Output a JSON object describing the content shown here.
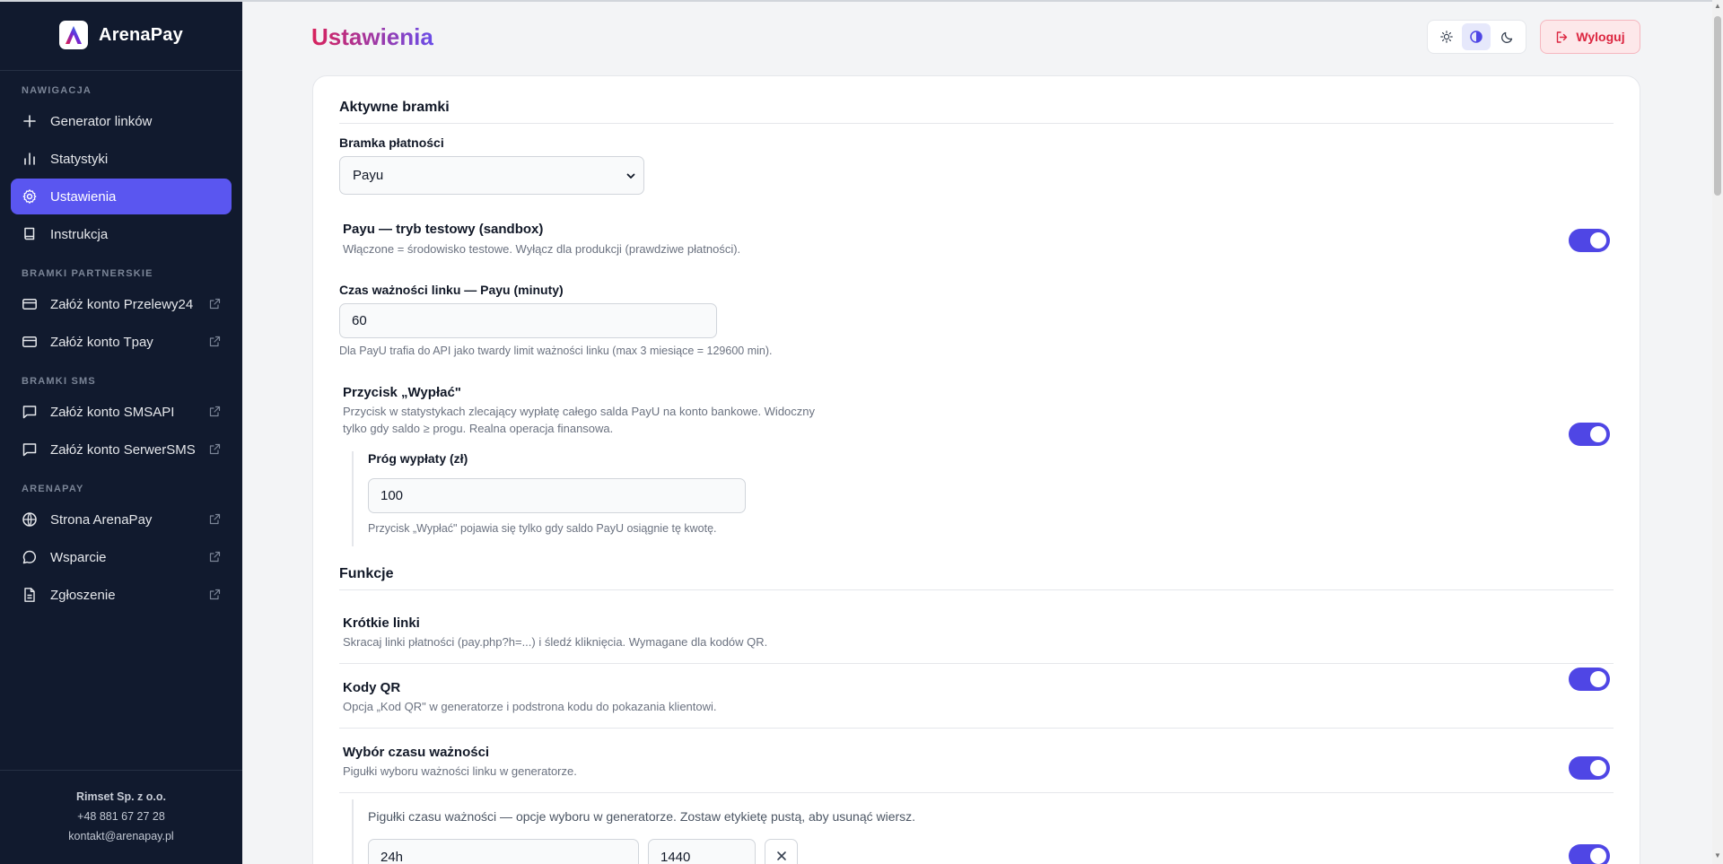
{
  "brand": {
    "name": "ArenaPay"
  },
  "sidebar": {
    "sections": {
      "nav": "NAWIGACJA",
      "partners": "BRAMKI PARTNERSKIE",
      "sms": "BRAMKI SMS",
      "arenapay": "ARENAPAY"
    },
    "items": [
      {
        "label": "Generator linków",
        "icon": "plus-icon"
      },
      {
        "label": "Statystyki",
        "icon": "bar-chart-icon"
      },
      {
        "label": "Ustawienia",
        "icon": "gear-icon",
        "active": true
      },
      {
        "label": "Instrukcja",
        "icon": "book-icon"
      },
      {
        "label": "Załóż konto Przelewy24",
        "icon": "credit-card-icon",
        "external": true
      },
      {
        "label": "Załóż konto Tpay",
        "icon": "credit-card-icon",
        "external": true
      },
      {
        "label": "Załóż konto SMSAPI",
        "icon": "message-icon",
        "external": true
      },
      {
        "label": "Załóż konto SerwerSMS",
        "icon": "message-icon",
        "external": true
      },
      {
        "label": "Strona ArenaPay",
        "icon": "globe-icon",
        "external": true
      },
      {
        "label": "Wsparcie",
        "icon": "chat-bubble-icon",
        "external": true
      },
      {
        "label": "Zgłoszenie",
        "icon": "file-icon",
        "external": true
      }
    ],
    "footer": {
      "company": "Rimset Sp. z o.o.",
      "phone": "+48 881 67 27 28",
      "email": "kontakt@arenapay.pl"
    }
  },
  "header": {
    "title": "Ustawienia",
    "logout_label": "Wyloguj",
    "theme_options": [
      "sun-icon",
      "contrast-icon",
      "moon-icon"
    ]
  },
  "gateways": {
    "section_title": "Aktywne bramki",
    "gateway_label": "Bramka płatności",
    "gateway_value": "Payu",
    "sandbox": {
      "title": "Payu — tryb testowy (sandbox)",
      "desc": "Włączone = środowisko testowe. Wyłącz dla produkcji (prawdziwe płatności).",
      "enabled": true
    },
    "expiry": {
      "label": "Czas ważności linku — Payu (minuty)",
      "value": "60",
      "help": "Dla PayU trafia do API jako twardy limit ważności linku (max 3 miesiące = 129600 min)."
    },
    "payout": {
      "title": "Przycisk „Wypłać\"",
      "desc_line1": "Przycisk w statystykach zlecający wypłatę całego salda PayU na konto bankowe. Widoczny",
      "desc_line2": "tylko gdy saldo ≥ progu. Realna operacja finansowa.",
      "enabled": true,
      "threshold_label": "Próg wypłaty (zł)",
      "threshold_value": "100",
      "threshold_help": "Przycisk „Wypłać\" pojawia się tylko gdy saldo PayU osiągnie tę kwotę."
    }
  },
  "features": {
    "section_title": "Funkcje",
    "short_links": {
      "title": "Krótkie linki",
      "desc": "Skracaj linki płatności (pay.php?h=...) i śledź kliknięcia. Wymagane dla kodów QR.",
      "enabled": true
    },
    "qr_codes": {
      "title": "Kody QR",
      "desc": "Opcja „Kod QR\" w generatorze i podstrona kodu do pokazania klientowi.",
      "enabled": true
    },
    "expiry_choice": {
      "title": "Wybór czasu ważności",
      "desc": "Pigułki wyboru ważności linku w generatorze.",
      "enabled": true,
      "pills_help": "Pigułki czasu ważności — opcje wyboru w generatorze. Zostaw etykietę pustą, aby usunąć wiersz.",
      "pill_rows": [
        {
          "label": "24h",
          "minutes": "1440"
        }
      ]
    }
  }
}
